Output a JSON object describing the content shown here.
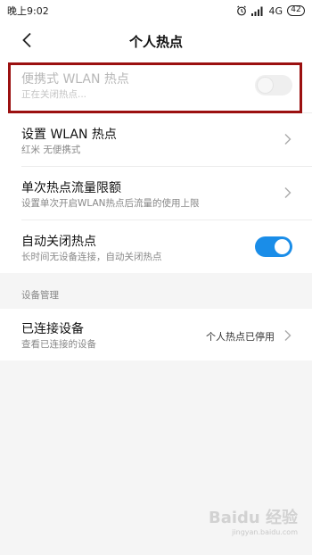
{
  "status_bar": {
    "time": "晚上9:02",
    "network": "4G",
    "battery": "42",
    "icons": [
      "alarm-icon",
      "signal-icon",
      "battery-icon"
    ]
  },
  "header": {
    "title": "个人热点",
    "back_icon": "chevron-left-icon"
  },
  "hotspot_toggle_row": {
    "title": "便携式 WLAN 热点",
    "subtitle": "正在关闭热点...",
    "enabled": false
  },
  "settings": [
    {
      "title": "设置 WLAN 热点",
      "subtitle": "红米 无便携式"
    },
    {
      "title": "单次热点流量限额",
      "subtitle": "设置单次开启WLAN热点后流量的使用上限"
    }
  ],
  "auto_off_row": {
    "title": "自动关闭热点",
    "subtitle": "长时间无设备连接，自动关闭热点",
    "enabled": true
  },
  "device_section": {
    "label": "设备管理",
    "title": "已连接设备",
    "subtitle": "查看已连接的设备",
    "status": "个人热点已停用"
  },
  "watermark": {
    "text": "Baidu 经验",
    "subtext": "jingyan.baidu.com"
  },
  "colors": {
    "accent": "#1a8de8",
    "highlight_border": "#9b1010",
    "background": "#f5f5f5"
  }
}
